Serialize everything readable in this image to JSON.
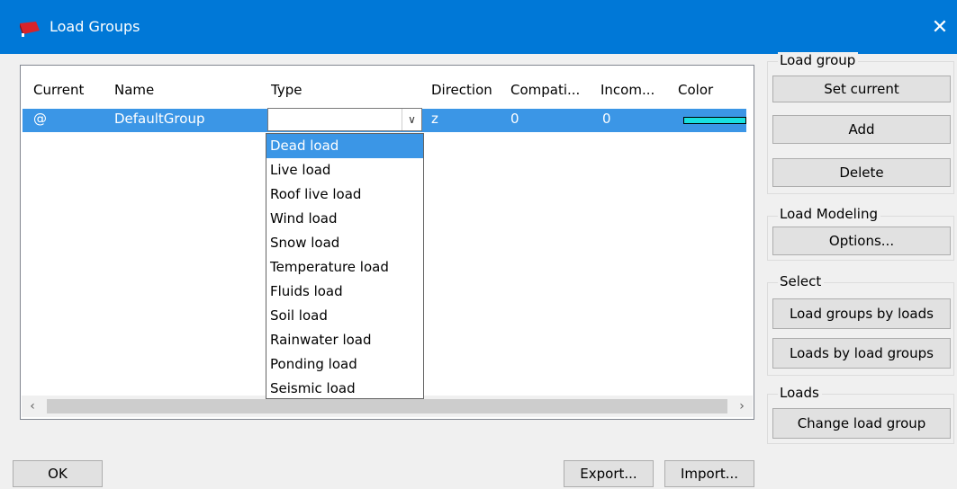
{
  "window": {
    "title": "Load Groups",
    "close_glyph": "✕"
  },
  "table": {
    "columns": [
      "Current",
      "Name",
      "Type",
      "Direction",
      "Compati...",
      "Incom...",
      "Color"
    ],
    "row": {
      "current": "@",
      "name": "DefaultGroup",
      "type": "",
      "direction": "z",
      "compatible": "0",
      "incompatible": "0",
      "color": "#19e0e0"
    }
  },
  "type_dropdown": {
    "options": [
      "Dead load",
      "Live load",
      "Roof live load",
      "Wind load",
      "Snow load",
      "Temperature load",
      "Fluids load",
      "Soil load",
      "Rainwater load",
      "Ponding load",
      "Seismic load"
    ],
    "highlighted": "Dead load"
  },
  "right_panel": {
    "load_group": {
      "label": "Load group",
      "set_current": "Set current",
      "add": "Add",
      "delete": "Delete"
    },
    "load_modeling": {
      "label": "Load Modeling",
      "options": "Options..."
    },
    "select": {
      "label": "Select",
      "groups_by_loads": "Load groups by loads",
      "loads_by_groups": "Loads by load groups"
    },
    "loads": {
      "label": "Loads",
      "change_group": "Change load group"
    }
  },
  "footer": {
    "ok": "OK",
    "export": "Export...",
    "import": "Import..."
  },
  "icons": {
    "scroll_left": "‹",
    "scroll_right": "›",
    "combo_arrow": "∨"
  },
  "colors": {
    "titlebar": "#0078d7",
    "selection": "#3b96e6"
  }
}
